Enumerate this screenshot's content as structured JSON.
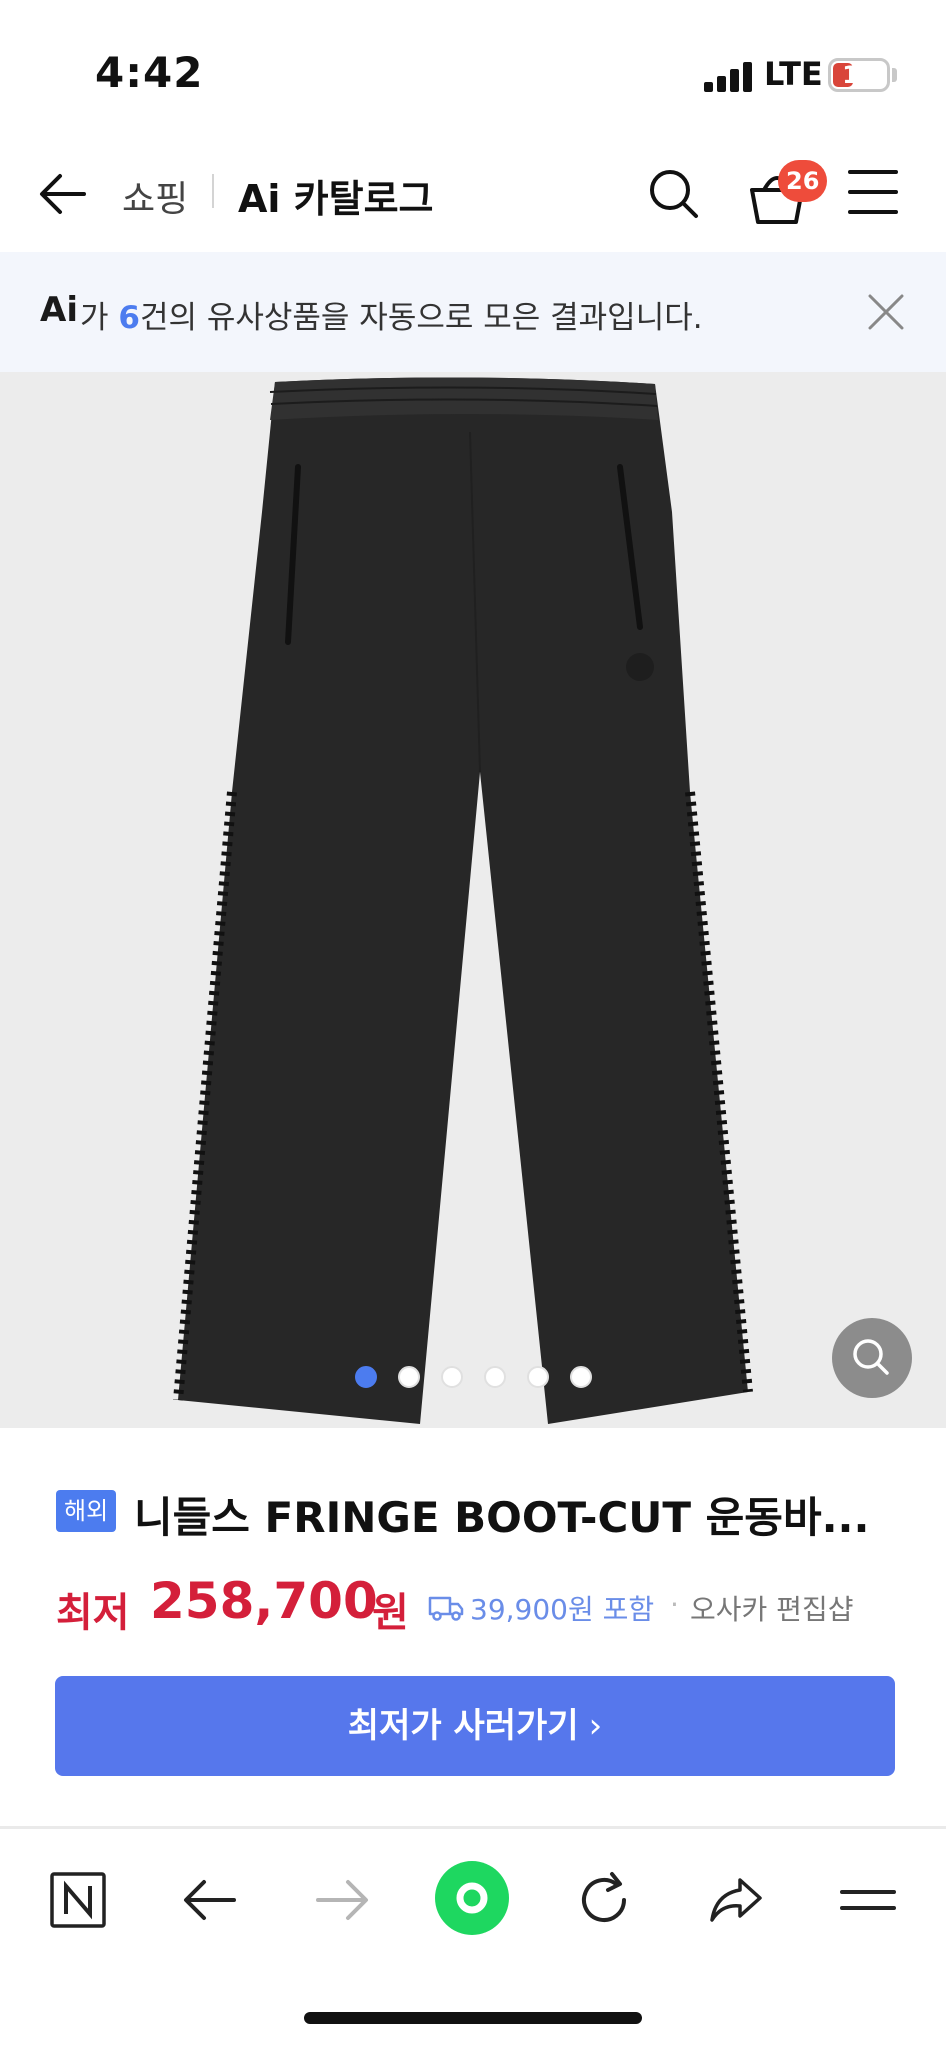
{
  "status_bar": {
    "time": "4:42",
    "network": "LTE",
    "battery": "11",
    "battery_level": 0.11
  },
  "header": {
    "breadcrumb_shop": "쇼핑",
    "title": "Ai 카탈로그",
    "cart_count": "26"
  },
  "ai_banner": {
    "logo": "Ai",
    "text_before_count": "가 ",
    "count": "6",
    "text_after_count": "건의 유사상품을 자동으로 모은 결과입니다."
  },
  "gallery": {
    "total_images": 6,
    "active_index": 0
  },
  "product": {
    "tag": "해외",
    "name": "니들스 FRINGE BOOT-CUT 운동바...",
    "price_prefix": "최저",
    "price": "258,700",
    "price_unit": "원",
    "delivery": "39,900원 포함",
    "separator": "·",
    "seller": "오사카 편집샵"
  },
  "cta": {
    "label": "최저가 사러가기",
    "chevron": "›"
  },
  "colors": {
    "accent": "#4c7cef",
    "button": "#5677ec",
    "price": "#d41f3a",
    "badge": "#ee4c3b",
    "browser_green": "#1ed760"
  },
  "icons": {
    "back": "arrow-left-icon",
    "search": "search-icon",
    "cart": "basket-icon",
    "menu": "hamburger-icon",
    "close": "close-icon",
    "zoom": "magnifier-icon",
    "delivery": "truck-icon",
    "toolbar": [
      "naver-n-icon",
      "back-arrow-icon",
      "forward-arrow-icon",
      "green-home-icon",
      "refresh-icon",
      "share-icon",
      "menu-icon"
    ]
  }
}
